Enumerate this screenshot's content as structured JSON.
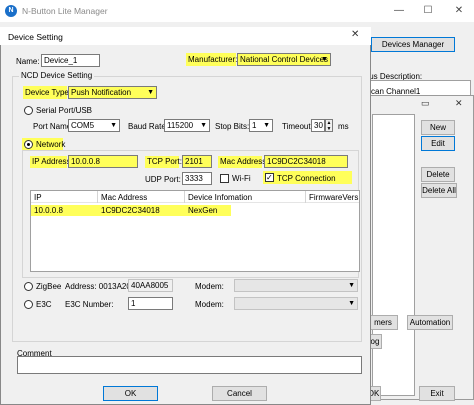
{
  "main_window": {
    "title": "N-Button Lite Manager",
    "app_icon": "N",
    "minimize_glyph": "—",
    "maximize_glyph": "☐",
    "close_glyph": "✕",
    "devices_manager_label": "Devices Manager",
    "status_label": "tus Description:",
    "scan_channel": "can Channel1",
    "lower_buttons": [
      "mers",
      "Automation",
      "og"
    ],
    "bottom_buttons": [
      "OK",
      "Exit"
    ]
  },
  "sub_dialog": {
    "close_glyph": "✕",
    "minimize_glyph": "▭",
    "buttons": [
      "New",
      "Edit",
      "Delete",
      "Delete All"
    ]
  },
  "dialog": {
    "title": "Device Setting",
    "close_glyph": "✕",
    "name_label": "Name:",
    "name_value": "Device_1",
    "manufacturer_label": "Manufacturer:",
    "manufacturer_value": "National Control Devices",
    "ncd_group_label": "NCD Device Setting",
    "device_type_label": "Device Type:",
    "device_type_value": "Push Notification",
    "serial_label": "Serial Port/USB",
    "port_name_label": "Port Name:",
    "port_name_value": "COM5",
    "baud_rate_label": "Baud Rate:",
    "baud_rate_value": "115200",
    "stop_bits_label": "Stop Bits:",
    "stop_bits_value": "1",
    "timeout_label": "Timeout:",
    "timeout_value": "30",
    "timeout_unit": "ms",
    "network_label": "Network",
    "ip_label": "IP Address:",
    "ip_value": "10.0.0.8",
    "tcp_port_label": "TCP Port:",
    "tcp_port_value": "2101",
    "mac_label": "Mac Address:",
    "mac_value": "1C9DC2C34018",
    "udp_port_label": "UDP Port:",
    "udp_port_value": "3333",
    "wifi_label": "Wi-Fi",
    "tcp_connection_label": "TCP Connection",
    "table": {
      "columns": [
        "IP",
        "Mac Address",
        "Device Infomation",
        "FirmwareVers"
      ],
      "rows": [
        [
          "10.0.0.8",
          "1C9DC2C34018",
          "NexGen",
          ""
        ]
      ]
    },
    "zigbee_label": "ZigBee",
    "zigbee_address_label": "Address: 0013A200-",
    "zigbee_address_value": "40AA8005",
    "modem_label": "Modem:",
    "e3c_label": "E3C",
    "e3c_number_label": "E3C Number:",
    "e3c_number_value": "1",
    "comment_label": "Comment",
    "ok_label": "OK",
    "cancel_label": "Cancel"
  },
  "colors": {
    "highlight": "#ffff5a",
    "focus_border": "#0078d7",
    "app_icon": "#1a6fc9"
  }
}
